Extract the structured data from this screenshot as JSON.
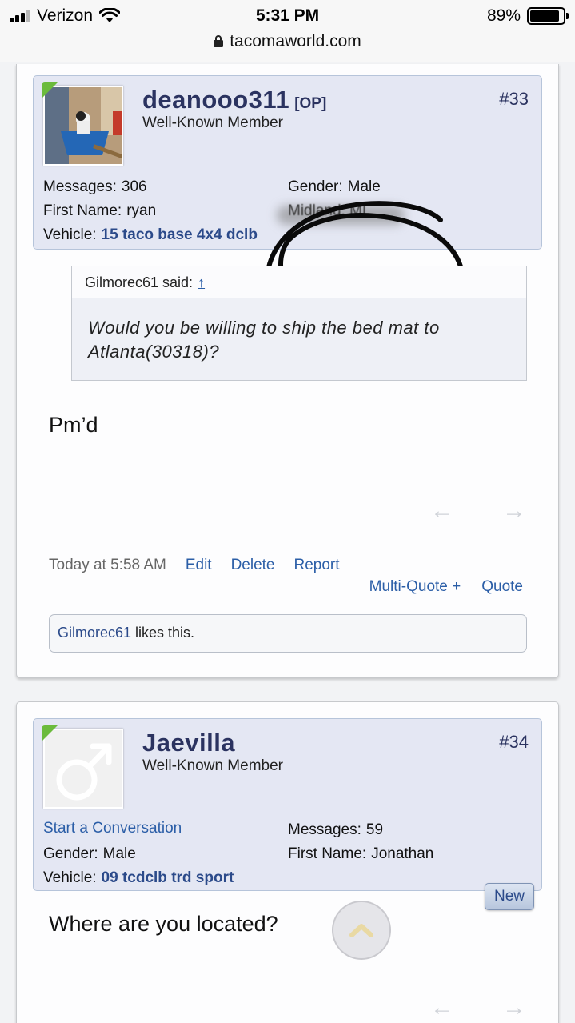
{
  "status_bar": {
    "carrier": "Verizon",
    "time": "5:31 PM",
    "battery_percent": "89%",
    "battery_level": 0.89,
    "url": "tacomaworld.com"
  },
  "posts": [
    {
      "username": "deanooo311",
      "op_tag": "[OP]",
      "user_title": "Well-Known Member",
      "post_number": "#33",
      "messages_label": "Messages:",
      "messages_value": "306",
      "firstname_label": "First Name:",
      "firstname_value": "ryan",
      "vehicle_label": "Vehicle:",
      "vehicle_value": "15 taco base 4x4 dclb",
      "gender_label": "Gender:",
      "gender_value": "Male",
      "location": "Midland, MI",
      "quote": {
        "author_line": "Gilmorec61 said:",
        "up_arrow": "↑",
        "text": "Would you be willing to ship the bed mat to Atlanta(30318)?"
      },
      "message": "Pm’d",
      "timestamp": "Today at 5:58 AM",
      "actions": [
        "Edit",
        "Delete",
        "Report"
      ],
      "actions2": [
        "Multi-Quote +",
        "Quote"
      ],
      "likes_user": "Gilmorec61",
      "likes_text": " likes this."
    },
    {
      "username": "Jaevilla",
      "user_title": "Well-Known Member",
      "post_number": "#34",
      "start_conversation": "Start a Conversation",
      "messages_label": "Messages:",
      "messages_value": "59",
      "gender_label": "Gender:",
      "gender_value": "Male",
      "firstname_label": "First Name:",
      "firstname_value": "Jonathan",
      "vehicle_label": "Vehicle:",
      "vehicle_value": "09 tcdclb trd sport",
      "message": "Where are you located?",
      "new_badge": "New"
    }
  ],
  "icons": {
    "prev": "←",
    "next": "→"
  }
}
